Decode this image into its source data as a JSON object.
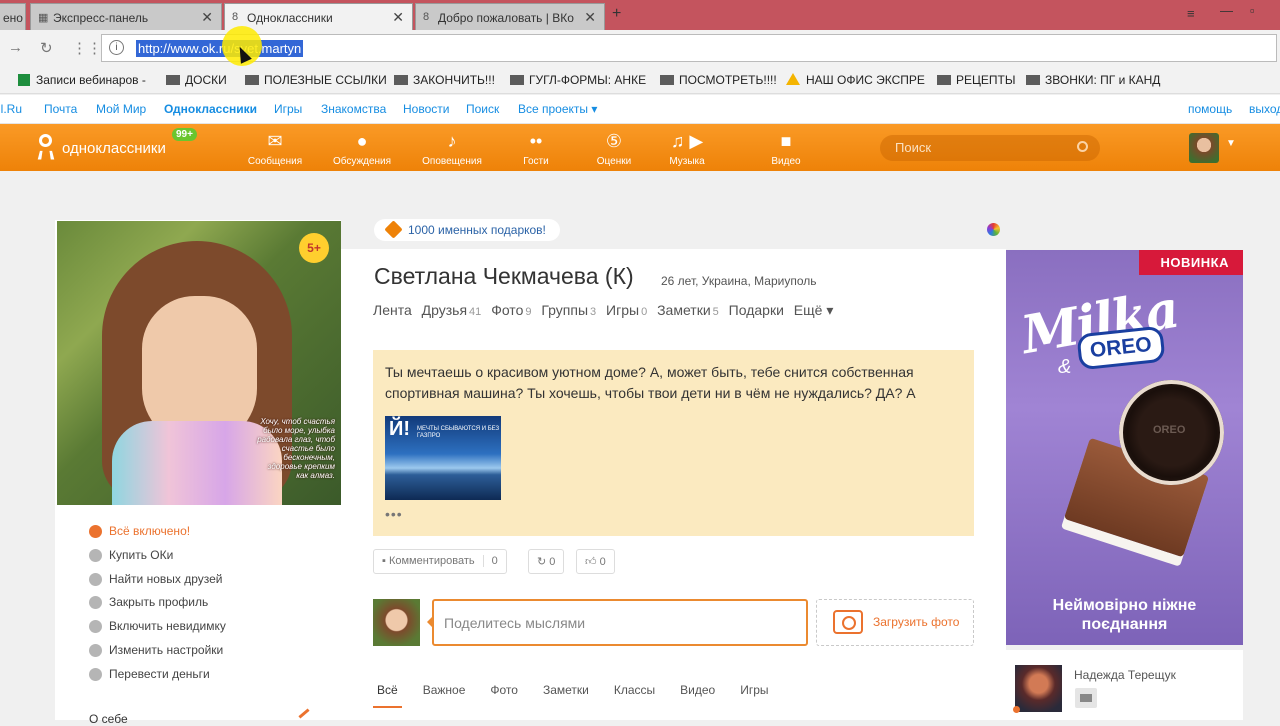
{
  "browser": {
    "tab_left_partial": "ено",
    "tabs": [
      {
        "label": "Экспресс-панель"
      },
      {
        "label": "Одноклассники"
      },
      {
        "label": "Добро пожаловать | ВКо"
      }
    ],
    "new_tab": "+",
    "url": "http://www.ok.ru/svet.martyn",
    "bookmarks": [
      {
        "label": "Записи вебинаров -"
      },
      {
        "label": "ДОСКИ"
      },
      {
        "label": "ПОЛЕЗНЫЕ ССЫЛКИ"
      },
      {
        "label": "ЗАКОНЧИТЬ!!!"
      },
      {
        "label": "ГУГЛ-ФОРМЫ: АНКЕ"
      },
      {
        "label": "ПОСМОТРЕТЬ!!!!"
      },
      {
        "label": "НАШ ОФИС ЭКСПРЕ"
      },
      {
        "label": "РЕЦЕПТЫ"
      },
      {
        "label": "ЗВОНКИ: ПГ и КАНД"
      }
    ]
  },
  "mailbar": {
    "links": [
      "il.Ru",
      "Почта",
      "Мой Мир",
      "Одноклассники",
      "Игры",
      "Знакомства",
      "Новости",
      "Поиск",
      "Все проекты ▾"
    ],
    "help": "помощь",
    "logout": "выход"
  },
  "header": {
    "logo": "одноклассники",
    "badge": "99+",
    "nav": [
      {
        "label": "Сообщения",
        "icon": "envelope-icon"
      },
      {
        "label": "Обсуждения",
        "icon": "chat-bubbles-icon"
      },
      {
        "label": "Оповещения",
        "icon": "bell-icon"
      },
      {
        "label": "Гости",
        "icon": "footprints-icon"
      },
      {
        "label": "Оценки",
        "icon": "rating-five-icon"
      },
      {
        "label": "Музыка",
        "icon": "music-note-icon"
      },
      {
        "label": "Видео",
        "icon": "video-camera-icon"
      }
    ],
    "search_placeholder": "Поиск"
  },
  "profile": {
    "age_badge": "5+",
    "photo_caption": "Хочу, чтоб счастья было море, улыбка радовала глаз, чтоб счастье было бесконечным, здоровье крепким как алмаз.",
    "menu": [
      {
        "label": "Всё включено!"
      },
      {
        "label": "Купить ОКи"
      },
      {
        "label": "Найти новых друзей"
      },
      {
        "label": "Закрыть профиль"
      },
      {
        "label": "Включить невидимку"
      },
      {
        "label": "Изменить настройки"
      },
      {
        "label": "Перевести деньги"
      }
    ],
    "about_label": "О себе",
    "gifts_banner": "1000 именных подарков!",
    "name": "Светлана Чекмачева (К)",
    "meta": "26 лет, Украина, Мариуполь",
    "tabs": [
      {
        "label": "Лента",
        "count": ""
      },
      {
        "label": "Друзья",
        "count": "41"
      },
      {
        "label": "Фото",
        "count": "9"
      },
      {
        "label": "Группы",
        "count": "3"
      },
      {
        "label": "Игры",
        "count": "0"
      },
      {
        "label": "Заметки",
        "count": "5"
      },
      {
        "label": "Подарки",
        "count": ""
      },
      {
        "label": "Ещё ▾",
        "count": ""
      }
    ]
  },
  "note": {
    "text": "Ты мечтаешь о красивом уютном доме? А, может быть, тебе снится собственная спортивная машина? Ты хочешь, чтобы твои дети ни в чём не нуждались? ДА? А",
    "image_big": "Й!",
    "image_small": "МЕЧТЫ СБЫВАЮТСЯ И БЕЗ ГАЗПРО",
    "more": "•••"
  },
  "actions": {
    "comment_label": "Комментировать",
    "comment_count": "0",
    "share_count": "0",
    "like_count": "0"
  },
  "composer": {
    "placeholder": "Поделитесь мыслями",
    "upload_label": "Загрузить фото"
  },
  "feed_tabs": [
    "Всё",
    "Важное",
    "Фото",
    "Заметки",
    "Классы",
    "Видео",
    "Игры"
  ],
  "ad": {
    "badge": "НОВИНКА",
    "brand": "Milka",
    "amp": "&",
    "partner": "OREO",
    "slogan_line1": "Неймовірно ніжне",
    "slogan_line2": "поєднання"
  },
  "friend": {
    "name": "Надежда Терещук"
  }
}
